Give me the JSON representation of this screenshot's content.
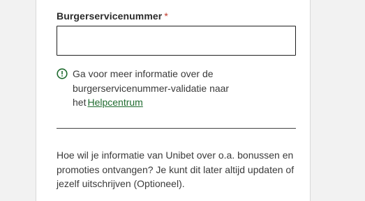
{
  "bsn_field": {
    "label": "Burgerservicenummer",
    "required_marker": "*",
    "value": "",
    "placeholder": ""
  },
  "info": {
    "icon": "info-circle-icon",
    "text": "Ga voor meer informatie over de burgerservicenummer-validatie naar het",
    "link_label": "Helpcentrum"
  },
  "marketing": {
    "question": "Hoe wil je informatie van Unibet over o.a. bonussen en promoties ontvangen? Je kunt dit later altijd updaten of jezelf uitschrijven (Optioneel)."
  },
  "colors": {
    "accent_green": "#1f6b2f",
    "required_red": "#c0392b"
  }
}
